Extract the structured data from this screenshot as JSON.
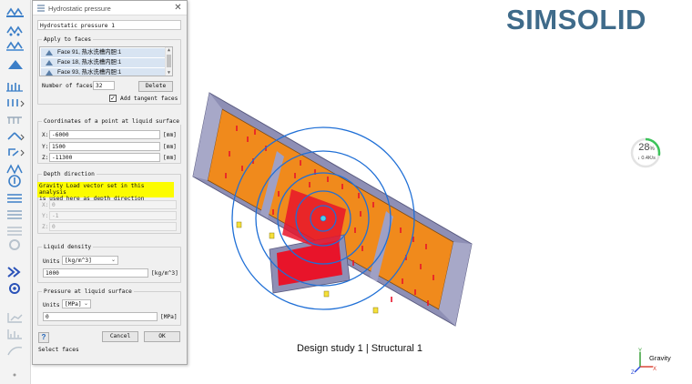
{
  "dialog": {
    "title": "Hydrostatic pressure",
    "name_value": "Hydrostatic pressure 1",
    "apply_section": "Apply to faces",
    "faces": [
      "Face 91, 热水洗槽内胆:1",
      "Face 18, 热水洗槽内胆:1",
      "Face 93, 热水洗槽内胆:1"
    ],
    "number_of_faces_label": "Number of faces",
    "number_of_faces_value": "32",
    "delete_label": "Delete",
    "add_tangent_label": "Add tangent faces",
    "add_tangent_checked": true,
    "coords_section": "Coordinates of a point at liquid surface",
    "x_label": "X:",
    "x_value": "-6000",
    "y_label": "Y:",
    "y_value": "1500",
    "z_label": "Z:",
    "z_value": "-11300",
    "coord_unit": "[mm]",
    "depth_section": "Depth direction",
    "depth_note_line1": "Gravity Load vector set in this analysis",
    "depth_note_line2": "is used here as depth direction",
    "dx_label": "X:",
    "dx_value": "0",
    "dy_label": "Y:",
    "dy_value": "-1",
    "dz_label": "Z:",
    "dz_value": "0",
    "density_section": "Liquid density",
    "units_label": "Units",
    "density_units": "[kg/m^3]",
    "density_value": "1000",
    "density_unit_suffix": "[kg/m^3]",
    "pressure_section": "Pressure at liquid surface",
    "pressure_units": "[MPa]",
    "pressure_value": "0",
    "pressure_unit_suffix": "[MPa]",
    "help_label": "?",
    "cancel_label": "Cancel",
    "ok_label": "OK",
    "status_text": "Select faces"
  },
  "viewport": {
    "logo": "SIMSOLID",
    "progress_percent": "28",
    "progress_pct_sign": "%",
    "progress_fraction": 0.28,
    "progress_rate": "↓ 0.4K/s",
    "study_label": "Design study 1 | Structural  1",
    "gravity_label": "Gravity",
    "triad": {
      "x": "X",
      "y": "Y",
      "z": "Z"
    }
  },
  "colors": {
    "logo": "#3f6b8a",
    "note_highlight": "#fcfc00",
    "model_orange": "#f08a1c",
    "model_frame": "#8e8fb5",
    "pressure_red": "#e8142a",
    "contour_blue": "#1f6fd6",
    "progress_green": "#3cc35a"
  }
}
